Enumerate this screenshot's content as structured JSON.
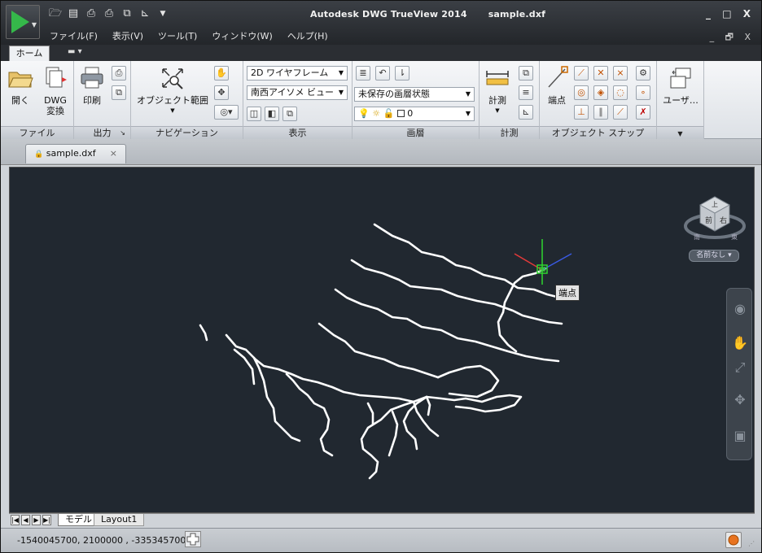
{
  "titlebar": {
    "app_name": "Autodesk DWG TrueView 2014",
    "file_name": "sample.dxf"
  },
  "window_controls": {
    "top": "_ □ X",
    "doc": "_ 🗗 X"
  },
  "menu": [
    "ファイル(F)",
    "表示(V)",
    "ツール(T)",
    "ウィンドウ(W)",
    "ヘルプ(H)"
  ],
  "ribbon": {
    "active_tab": "ホーム",
    "panels": {
      "file": {
        "title": "ファイル",
        "open_label": "開く",
        "dwg_label_1": "DWG",
        "dwg_label_2": "変換"
      },
      "output": {
        "title": "出力",
        "print_label": "印刷",
        "expand": "↘"
      },
      "navigation": {
        "title": "ナビゲーション",
        "extent_label": "オブジェクト範囲"
      },
      "display": {
        "title": "表示",
        "visual_style": "2D ワイヤフレーム",
        "view": "南西アイソメ ビュー"
      },
      "layers": {
        "title": "画層",
        "layer_state": "未保存の画層状態",
        "current_layer": "0"
      },
      "measure": {
        "title": "計測",
        "measure_label": "計測"
      },
      "osnap": {
        "title": "オブジェクト スナップ",
        "endpoint_label": "端点"
      },
      "user": {
        "title": "",
        "user_label": "ユーザ…"
      }
    }
  },
  "doc_tab": {
    "label": "sample.dxf",
    "close": "×"
  },
  "canvas": {
    "tooltip": "端点",
    "viewcube": {
      "top": "上",
      "front": "前",
      "right": "右",
      "south": "南",
      "east": "東"
    },
    "named_view": "名前なし"
  },
  "layout_tabs": [
    "モデル",
    "Layout1"
  ],
  "status": {
    "coords": "-1540045700, 2100000  , -335345700"
  },
  "colors": {
    "canvas_bg": "#212830",
    "crosshair_y": "#2fd62f",
    "crosshair_x": "#e23a3a",
    "crosshair_z": "#3a5ae2",
    "geometry": "#ffffff"
  }
}
